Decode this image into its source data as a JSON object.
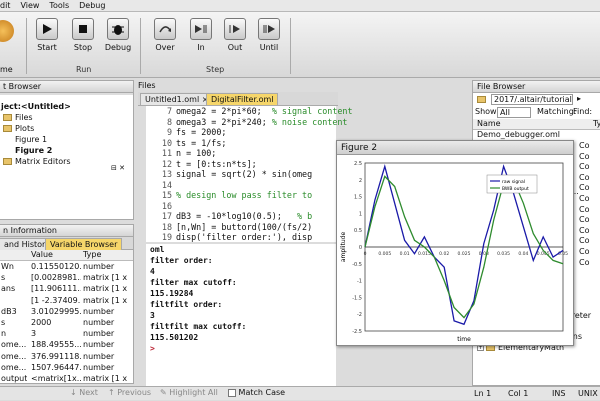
{
  "menu": [
    "dit",
    "View",
    "Tools",
    "Debug"
  ],
  "ribbon": {
    "home_label": "me",
    "run_buttons": [
      {
        "label": "Start",
        "icon": "play-icon"
      },
      {
        "label": "Stop",
        "icon": "stop-icon"
      },
      {
        "label": "Debug",
        "icon": "bug-icon"
      }
    ],
    "run_group": "Run",
    "step_buttons": [
      {
        "label": "Over",
        "icon": "step-over-icon"
      },
      {
        "label": "In",
        "icon": "step-in-icon"
      },
      {
        "label": "Out",
        "icon": "step-out-icon"
      },
      {
        "label": "Until",
        "icon": "run-until-icon"
      }
    ],
    "step_group": "Step"
  },
  "project_browser": {
    "title": "t Browser",
    "items": [
      "ject:<Untitled>",
      "Files",
      "Plots",
      "Figure 1",
      "Figure 2",
      "Matrix Editors"
    ]
  },
  "editor": {
    "files_label": "Files",
    "tabs": [
      "Untitled1.oml",
      "DigitalFilter.oml"
    ],
    "lines": [
      {
        "n": "7",
        "code": "omega2 = 2*pi*60;  ",
        "comment": "% signal content"
      },
      {
        "n": "8",
        "code": "omega3 = 2*pi*240; ",
        "comment": "% noise content"
      },
      {
        "n": "9",
        "code": "fs = 2000;",
        "comment": ""
      },
      {
        "n": "10",
        "code": "ts = 1/fs;",
        "comment": ""
      },
      {
        "n": "11",
        "code": "n = 100;",
        "comment": ""
      },
      {
        "n": "12",
        "code": "t = [0:ts:n*ts];",
        "comment": ""
      },
      {
        "n": "13",
        "code": "signal = sqrt(2) * sin(omeg",
        "comment": ""
      },
      {
        "n": "14",
        "code": "",
        "comment": ""
      },
      {
        "n": "15",
        "code": "",
        "comment": "% design low pass filter to"
      },
      {
        "n": "16",
        "code": "",
        "comment": ""
      },
      {
        "n": "17",
        "code": "dB3 = -10*log10(0.5);   ",
        "comment": "% b"
      },
      {
        "n": "18",
        "code": "[n,Wn] = buttord(100/(fs/2)",
        "comment": ""
      },
      {
        "n": "19",
        "code": "disp('filter order:'), disp",
        "comment": ""
      }
    ]
  },
  "console": {
    "lines": [
      "oml",
      "filter order:",
      "4",
      "filter max cutoff:",
      "115.19284",
      "filtfilt order:",
      "3",
      "filtfilt max cutoff:",
      "115.501202",
      ">"
    ]
  },
  "variables": {
    "title": "n Information",
    "tabs": [
      "and History",
      "Variable Browser"
    ],
    "headers": [
      "",
      "Value",
      "Type"
    ],
    "rows": [
      {
        "name": "Wn",
        "value": "0.11550120...",
        "type": "number"
      },
      {
        "name": "s",
        "value": "[0.0028981...",
        "type": "matrix [1 x"
      },
      {
        "name": "ans",
        "value": "[11.906111...",
        "type": "matrix [1 x"
      },
      {
        "name": "",
        "value": "[1 -2.37409...",
        "type": "matrix [1 x"
      },
      {
        "name": "dB3",
        "value": "3.01029995...",
        "type": "number"
      },
      {
        "name": "s",
        "value": "2000",
        "type": "number"
      },
      {
        "name": "n",
        "value": "3",
        "type": "number"
      },
      {
        "name": "ome...",
        "value": "188.49555...",
        "type": "number"
      },
      {
        "name": "ome...",
        "value": "376.991118...",
        "type": "number"
      },
      {
        "name": "ome...",
        "value": "1507.96447...",
        "type": "number"
      },
      {
        "name": "output",
        "value": "<matrix[1x...",
        "type": "matrix [1 x"
      }
    ]
  },
  "figure": {
    "title": "Figure 2",
    "legend": [
      "raw signal",
      "BWB output"
    ],
    "xlabel": "time",
    "ylabel": "amplitude",
    "y_ticks": [
      "2.5",
      "2",
      "1.5",
      "1",
      "0.5",
      "0",
      "-0.5",
      "-1",
      "-1.5",
      "-2",
      "-2.5"
    ],
    "x_ticks": [
      "0",
      "0.005",
      "0.01",
      "0.015",
      "0.02",
      "0.025",
      "0.03",
      "0.035",
      "0.04",
      "0.045",
      "0.05"
    ]
  },
  "file_browser": {
    "title": "File Browser",
    "path": "2017/.altair/tutorials",
    "show_label": "Show:",
    "show_value": "All",
    "matching_label": "Matching:",
    "find_label": "Find:",
    "col_name": "Name",
    "col_type": "Ty",
    "top_item": "Demo_debugger.oml",
    "types": [
      "Co",
      "Co",
      "Co",
      "Co",
      "Co",
      "Co",
      "Co",
      "Co",
      "Co",
      "Co",
      "Co",
      "Co"
    ],
    "extra": "s...",
    "folders": [
      "CoreMinimalInterpreter",
      "DataStructures",
      "DifferentialEquations",
      "ElementaryMath"
    ]
  },
  "find_bar": {
    "next": "Next",
    "previous": "Previous",
    "highlight": "Highlight All",
    "match_case": "Match Case"
  },
  "status": {
    "line": "Ln 1",
    "col": "Col 1",
    "ins": "INS",
    "encoding": "UTF-8",
    "eol": "UNIX"
  },
  "colors": {
    "raw_signal": "#1a1aa8",
    "filtered": "#2e8b2e",
    "highlight_tab": "#f6d66a"
  },
  "chart_data": {
    "type": "line",
    "xlim": [
      0,
      0.05
    ],
    "ylim": [
      -2.5,
      2.5
    ],
    "xlabel": "time",
    "ylabel": "amplitude",
    "series": [
      {
        "name": "raw signal",
        "color": "#1a1aa8",
        "x": [
          0,
          0.0025,
          0.005,
          0.0075,
          0.01,
          0.0125,
          0.015,
          0.0175,
          0.02,
          0.0225,
          0.025,
          0.0275,
          0.03,
          0.0325,
          0.035,
          0.0375,
          0.04,
          0.0425,
          0.045,
          0.0475,
          0.05
        ],
        "y": [
          0,
          1.4,
          2.4,
          1.3,
          0.2,
          -0.2,
          0.3,
          -0.3,
          -0.6,
          -2.2,
          -2.3,
          -1.6,
          0.1,
          1.1,
          2.4,
          1.6,
          0.6,
          -0.4,
          0.3,
          -0.3,
          -0.1
        ]
      },
      {
        "name": "BWB output",
        "color": "#2e8b2e",
        "x": [
          0,
          0.0025,
          0.005,
          0.0075,
          0.01,
          0.0125,
          0.015,
          0.0175,
          0.02,
          0.0225,
          0.025,
          0.0275,
          0.03,
          0.0325,
          0.035,
          0.0375,
          0.04,
          0.0425,
          0.045,
          0.0475,
          0.05
        ],
        "y": [
          0,
          1.2,
          2.1,
          1.8,
          0.9,
          0.2,
          0,
          -0.3,
          -1.0,
          -1.8,
          -2.1,
          -1.7,
          -0.6,
          0.8,
          1.9,
          2.0,
          1.3,
          0.4,
          -0.1,
          -0.4,
          -0.5
        ]
      }
    ]
  }
}
